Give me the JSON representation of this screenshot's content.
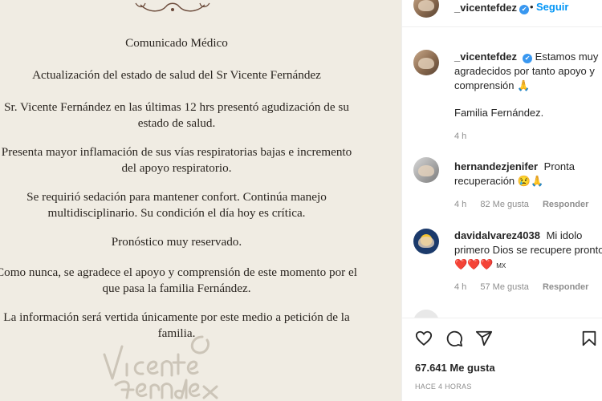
{
  "document": {
    "lines": [
      "Comunicado Médico",
      "Actualización del estado de salud del Sr Vicente Fernández",
      "Sr. Vicente Fernández en las últimas 12 hrs presentó agudización de su",
      "estado de salud.",
      "Presenta mayor inflamación de sus vías respiratorias bajas e incremento",
      "del apoyo respiratorio.",
      "Se requirió sedación para mantener confort. Continúa manejo",
      "multidisciplinario. Su condición el día hoy es crítica.",
      "Pronóstico muy reservado.",
      "Como nunca, se agradece el apoyo y comprensión de este momento por el",
      "que pasa la familia Fernández.",
      "La información será vertida únicamente por este medio a petición de la",
      "familia."
    ],
    "signature_text": "Vicente Fernandez"
  },
  "header": {
    "username": "_vicentefdez",
    "verified_glyph": "✔",
    "follow_label": "Seguir"
  },
  "caption": {
    "username": "_vicentefdez",
    "text": "Estamos muy agradecidos por tanto apoyo y comprensión 🙏",
    "signoff": "Familia Fernández.",
    "time": "4 h"
  },
  "comments": [
    {
      "username": "hernandezjenifer",
      "text": "Pronta recuperación 😢🙏",
      "time": "4 h",
      "likes": "82 Me gusta",
      "reply": "Responder"
    },
    {
      "username": "davidalvarez4038",
      "text": "Mi idolo primero Dios se recupere pronto",
      "hearts": "❤️❤️❤️",
      "extra": "MX",
      "time": "4 h",
      "likes": "57 Me gusta",
      "reply": "Responder"
    }
  ],
  "actions": {
    "icons": [
      "heart-icon",
      "comment-icon",
      "share-icon",
      "save-icon"
    ],
    "likes": "67.641 Me gusta",
    "time_ago": "HACE 4 HORAS"
  },
  "colors": {
    "accent": "#0095f6",
    "verified": "#3897f0",
    "heart": "#ed4956",
    "image_bg": "#f0ece3"
  }
}
